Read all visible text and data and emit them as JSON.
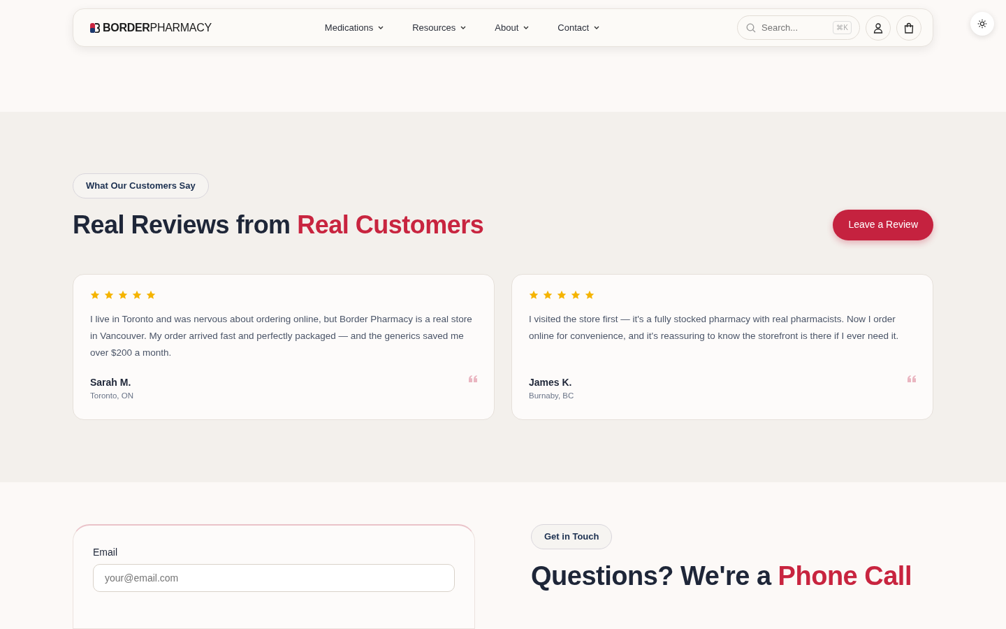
{
  "navbar": {
    "logo": {
      "bold": "BORDER",
      "light": "PHARMACY"
    },
    "menu": [
      {
        "label": "Medications"
      },
      {
        "label": "Resources"
      },
      {
        "label": "About"
      },
      {
        "label": "Contact"
      }
    ],
    "search": {
      "placeholder": "Search...",
      "shortcut": "⌘K"
    }
  },
  "reviews": {
    "badge": "What Our Customers Say",
    "heading": "Real Reviews from",
    "heading_highlight": "Real Customers",
    "button": "Leave a Review",
    "items": [
      {
        "stars": 5,
        "text": "I live in Toronto and was nervous about ordering online, but Border Pharmacy is a real store in Vancouver. My order arrived fast and perfectly packaged — and the generics saved me over $200 a month.",
        "name": "Sarah M.",
        "location": "Toronto, ON"
      },
      {
        "stars": 5,
        "text": "I visited the store first — it's a fully stocked pharmacy with real pharmacists. Now I order online for convenience, and it's reassuring to know the storefront is there if I ever need it.",
        "name": "James K.",
        "location": "Burnaby, BC"
      }
    ]
  },
  "contact": {
    "form": {
      "email_label": "Email",
      "email_placeholder": "your@email.com"
    },
    "badge": "Get in Touch",
    "heading": "Questions? We're a",
    "heading_highlight": "Phone Call"
  }
}
